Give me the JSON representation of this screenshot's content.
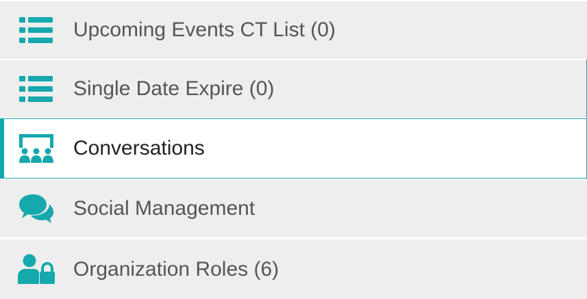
{
  "accent_color": "#15a8ad",
  "menu": {
    "items": [
      {
        "label": "Upcoming Events CT List (0)",
        "icon": "list-icon",
        "active": false
      },
      {
        "label": "Single Date Expire (0)",
        "icon": "list-icon",
        "active": false
      },
      {
        "label": "Conversations",
        "icon": "conversations-icon",
        "active": true
      },
      {
        "label": "Social Management",
        "icon": "chat-bubbles-icon",
        "active": false
      },
      {
        "label": "Organization Roles (6)",
        "icon": "user-lock-icon",
        "active": false
      }
    ]
  }
}
